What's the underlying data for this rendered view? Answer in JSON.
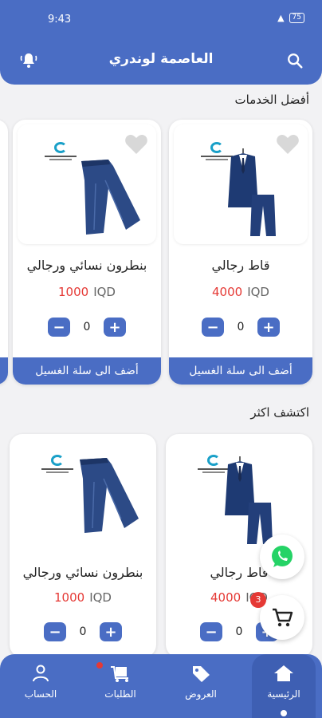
{
  "status_bar": {
    "time": "9:43",
    "battery": "75"
  },
  "header": {
    "title": "العاصمة لوندري"
  },
  "sections": {
    "best": "أفضل الخدمات",
    "explore": "اكتشف اكثر"
  },
  "best_services": [
    {
      "name": "قاط رجالي",
      "price": "4000",
      "currency": "IQD",
      "qty": "0",
      "add_label": "أضف الى سلة الغسيل",
      "image": "suit"
    },
    {
      "name": "بنطرون نسائي ورجالي",
      "price": "1000",
      "currency": "IQD",
      "qty": "0",
      "add_label": "أضف الى سلة الغسيل",
      "image": "jeans"
    }
  ],
  "explore_items": [
    {
      "name": "قاط رجالي",
      "price": "4000",
      "currency": "IQD",
      "qty": "0",
      "image": "suit"
    },
    {
      "name": "بنطرون نسائي ورجالي",
      "price": "1000",
      "currency": "IQD",
      "qty": "0",
      "image": "jeans"
    }
  ],
  "cart": {
    "count": "3"
  },
  "bottom_nav": [
    {
      "label": "الرئيسية",
      "icon": "home-icon",
      "active": true
    },
    {
      "label": "العروض",
      "icon": "tag-icon"
    },
    {
      "label": "الطلبات",
      "icon": "cart-box-icon"
    },
    {
      "label": "الحساب",
      "icon": "person-icon"
    }
  ],
  "colors": {
    "primary": "#4a6dc4",
    "price": "#e53935",
    "whatsapp": "#25d366"
  }
}
